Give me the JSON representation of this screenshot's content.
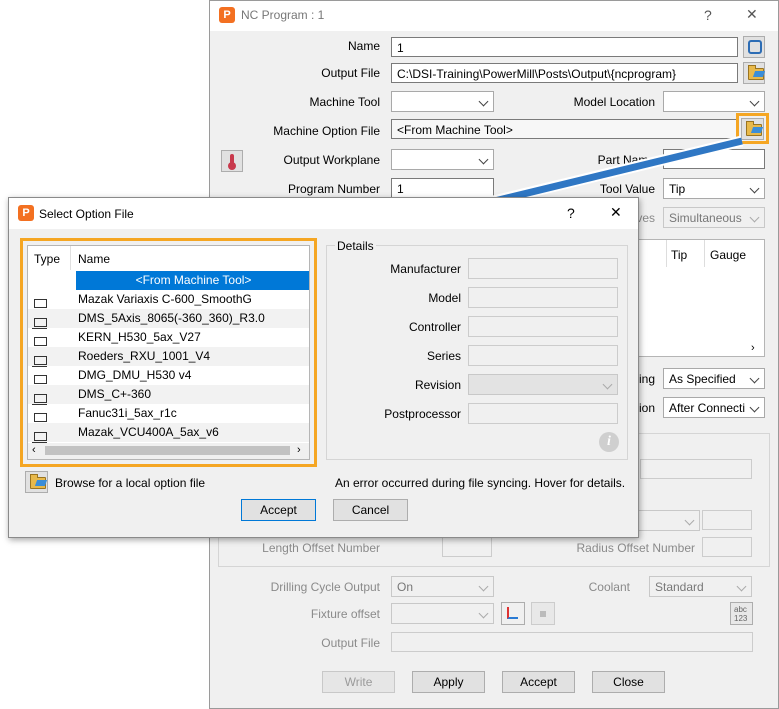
{
  "nc": {
    "title": "NC Program : 1",
    "help": "?",
    "close": "✕",
    "name_label": "Name",
    "name_value": "1",
    "output_file_label": "Output File",
    "output_file_value": "C:\\DSI-Training\\PowerMill\\Posts\\Output\\{ncprogram}",
    "machine_tool_label": "Machine Tool",
    "model_location_label": "Model Location",
    "machine_option_file_label": "Machine Option File",
    "machine_option_file_value": "<From Machine Tool>",
    "output_workplane_label": "Output Workplane",
    "part_name_label": "Part Name",
    "program_number_label": "Program Number",
    "program_number_value": "1",
    "tool_value_label": "Tool Value",
    "tool_value_value": "Tip",
    "moves_label_partial": "ves",
    "moves_value": "Simultaneous",
    "list_col_tip": "Tip",
    "list_col_gauge": "Gauge",
    "ing_label_partial": "ing",
    "ing_value": "As Specified",
    "ion_label_partial": "ion",
    "ion_value": "After Connecti",
    "length_offset_label": "Length Offset Number",
    "radius_offset_label": "Radius Offset Number",
    "drilling_cycle_label": "Drilling Cycle Output",
    "drilling_cycle_value": "On",
    "coolant_label": "Coolant",
    "coolant_value": "Standard",
    "fixture_offset_label": "Fixture offset",
    "output_file2_label": "Output File",
    "abc_icon_text": "abc\n123",
    "buttons": {
      "write": "Write",
      "apply": "Apply",
      "accept": "Accept",
      "close": "Close"
    }
  },
  "dialog": {
    "title": "Select Option File",
    "help": "?",
    "close": "✕",
    "col_type": "Type",
    "col_name": "Name",
    "items": [
      {
        "name": "<From Machine Tool>",
        "type": ""
      },
      {
        "name": "Mazak Variaxis C-600_SmoothG",
        "type": "laptop"
      },
      {
        "name": "DMS_5Axis_8065(-360_360)_R3.0",
        "type": "laptop"
      },
      {
        "name": "KERN_H530_5ax_V27",
        "type": "laptop"
      },
      {
        "name": "Roeders_RXU_1001_V4",
        "type": "laptop"
      },
      {
        "name": "DMG_DMU_H530 v4",
        "type": "laptop"
      },
      {
        "name": "DMS_C+-360",
        "type": "laptop"
      },
      {
        "name": "Fanuc31i_5ax_r1c",
        "type": "laptop"
      },
      {
        "name": "Mazak_VCU400A_5ax_v6",
        "type": "laptop"
      }
    ],
    "details_label": "Details",
    "details": {
      "manufacturer": "Manufacturer",
      "model": "Model",
      "controller": "Controller",
      "series": "Series",
      "revision": "Revision",
      "postprocessor": "Postprocessor"
    },
    "browse_label": "Browse for a local option file",
    "error_text": "An error occurred during file syncing. Hover for details.",
    "accept": "Accept",
    "cancel": "Cancel"
  },
  "colors": {
    "highlight": "#f5a623",
    "arrow": "#2f77c4",
    "selection": "#0078d7"
  }
}
